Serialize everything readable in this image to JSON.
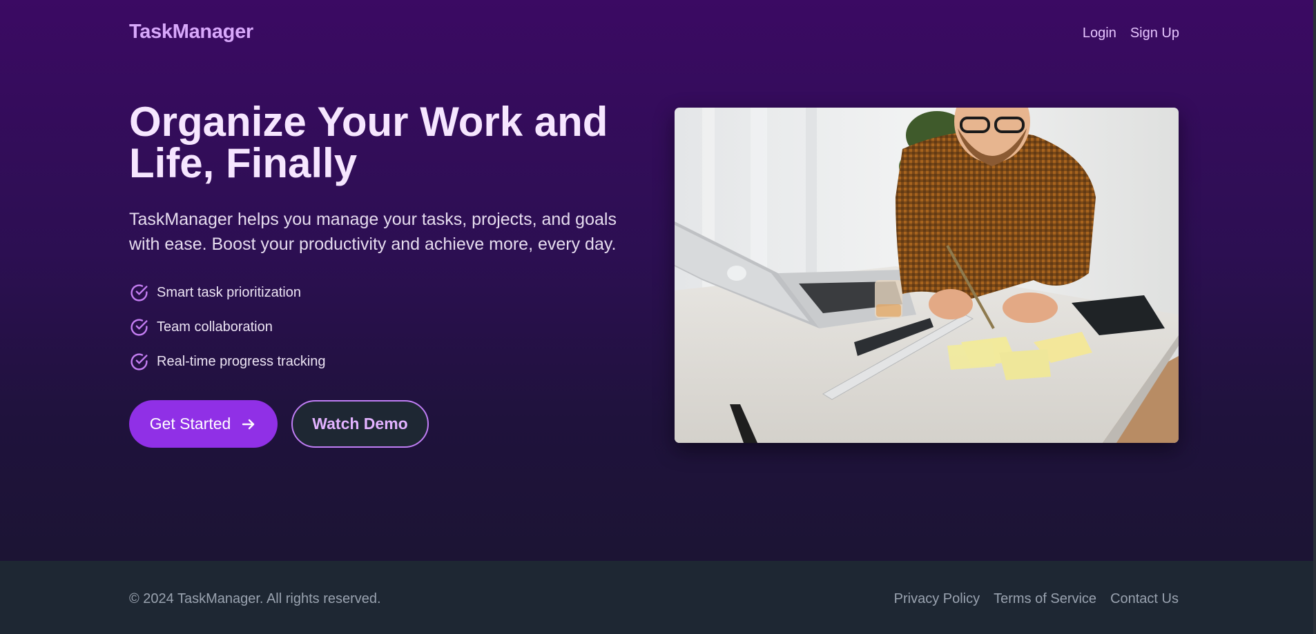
{
  "header": {
    "brand": "TaskManager",
    "nav": {
      "login": "Login",
      "signup": "Sign Up"
    }
  },
  "hero": {
    "headline": "Organize Your Work and Life, Finally",
    "subtitle": "TaskManager helps you manage your tasks, projects, and goals with ease. Boost your productivity and achieve more, every day.",
    "features": [
      {
        "label": "Smart task prioritization",
        "icon": "check-circle-icon"
      },
      {
        "label": "Team collaboration",
        "icon": "check-circle-icon"
      },
      {
        "label": "Real-time progress tracking",
        "icon": "check-circle-icon"
      }
    ],
    "cta_primary": {
      "label": "Get Started",
      "icon": "arrow-right-icon"
    },
    "cta_secondary": {
      "label": "Watch Demo"
    },
    "image": {
      "alt": "Man writing on sticky notes at a desk with a laptop"
    }
  },
  "footer": {
    "copyright": "© 2024 TaskManager. All rights reserved.",
    "links": [
      "Privacy Policy",
      "Terms of Service",
      "Contact Us"
    ]
  },
  "colors": {
    "hero_top": "#3b0a63",
    "hero_bottom": "#1c1434",
    "accent": "#9030e6",
    "brand": "#d8a8fb",
    "footer_bg": "#1e2733"
  }
}
